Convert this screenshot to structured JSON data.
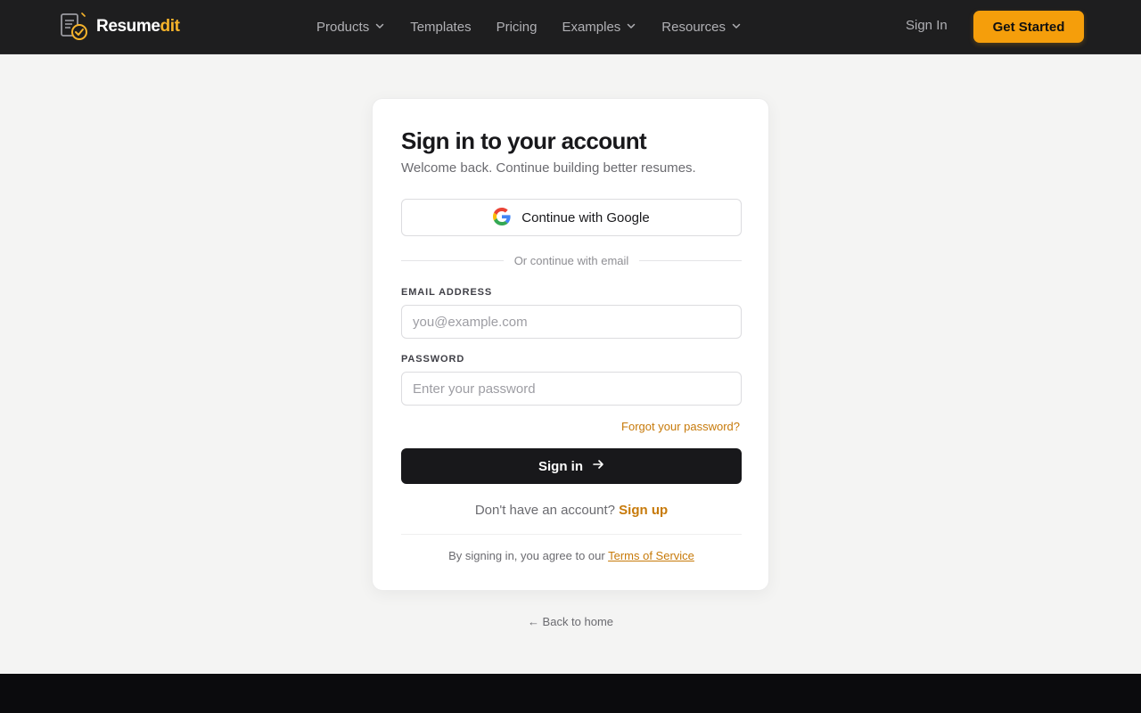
{
  "brand": {
    "name_main": "Resume",
    "name_accent": "dit",
    "accent_color": "#f5b32b"
  },
  "nav": {
    "items": [
      {
        "label": "Products",
        "has_dropdown": true
      },
      {
        "label": "Templates",
        "has_dropdown": false
      },
      {
        "label": "Pricing",
        "has_dropdown": false
      },
      {
        "label": "Examples",
        "has_dropdown": true
      },
      {
        "label": "Resources",
        "has_dropdown": true
      }
    ],
    "sign_in": "Sign In",
    "cta": "Get Started",
    "cta_color": "#f59e0b"
  },
  "card": {
    "title": "Sign in to your account",
    "subtitle": "Welcome back. Continue building better resumes.",
    "google_button": "Continue with Google",
    "divider": "Or continue with email",
    "email_label": "EMAIL ADDRESS",
    "email_placeholder": "you@example.com",
    "email_value": "",
    "password_label": "PASSWORD",
    "password_placeholder": "Enter your password",
    "password_value": "",
    "forgot": "Forgot your password?",
    "submit": "Sign in",
    "no_account": "Don't have an account?",
    "signup": "Sign up",
    "legal_prefix": "By signing in, you agree to our",
    "tos": "Terms of Service"
  },
  "back_home": "← Back to home",
  "icons": {
    "logo": "resume-check-icon",
    "google": "google-g-icon",
    "dropdown": "chevron-down-icon",
    "submit_arrow": "arrow-right-icon"
  }
}
